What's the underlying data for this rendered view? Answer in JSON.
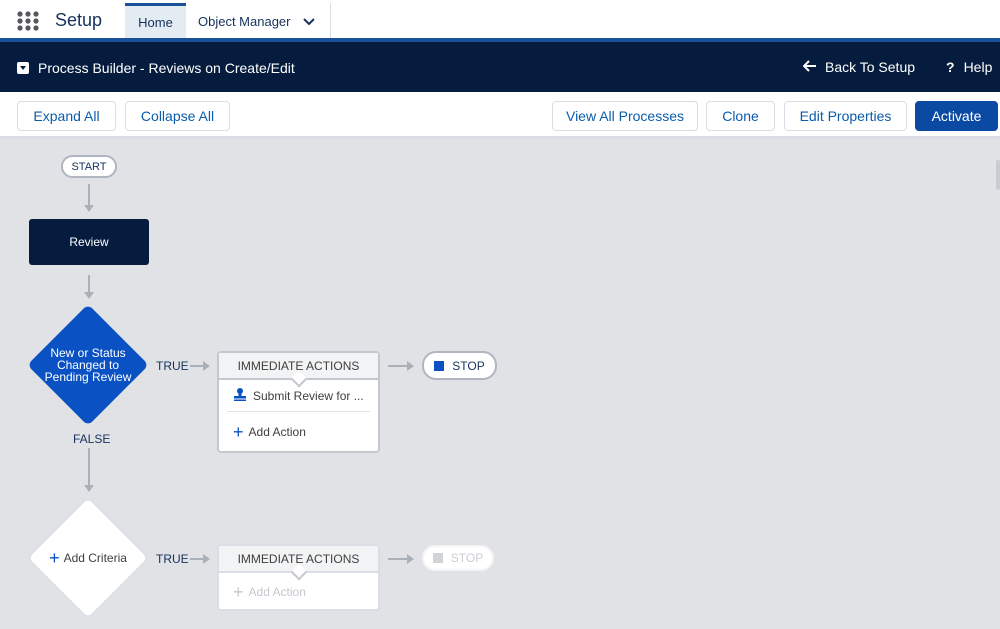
{
  "topnav": {
    "app_title": "Setup",
    "tabs": [
      {
        "label": "Home"
      },
      {
        "label": "Object Manager"
      }
    ]
  },
  "header": {
    "title": "Process Builder - Reviews on Create/Edit",
    "back_label": "Back To Setup",
    "help_label": "Help"
  },
  "toolbar": {
    "expand_all": "Expand All",
    "collapse_all": "Collapse All",
    "view_all": "View All Processes",
    "clone": "Clone",
    "edit_properties": "Edit Properties",
    "activate": "Activate"
  },
  "canvas": {
    "start": "START",
    "object_node": "Review",
    "criteria": [
      {
        "label": "New or Status Changed to Pending Review",
        "true_label": "TRUE",
        "false_label": "FALSE",
        "actions_header": "IMMEDIATE ACTIONS",
        "actions": [
          {
            "label": "Submit Review for ...",
            "icon": "approval-stamp-icon"
          }
        ],
        "add_action": "Add Action",
        "stop": "STOP"
      },
      {
        "label": "Add Criteria",
        "true_label": "TRUE",
        "actions_header": "IMMEDIATE ACTIONS",
        "add_action": "Add Action",
        "stop": "STOP"
      }
    ]
  },
  "colors": {
    "navy": "#061c3f",
    "brand": "#0b4aa2",
    "diamond": "#0a52c4"
  }
}
